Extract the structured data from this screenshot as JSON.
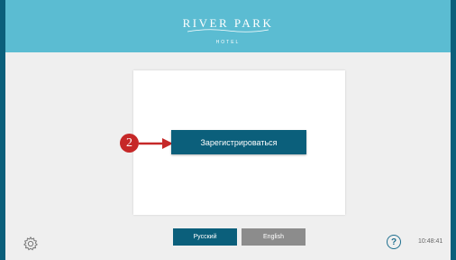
{
  "header": {
    "logo_title": "RIVER PARK",
    "logo_subtitle": "HOTEL"
  },
  "main": {
    "step_marker": "2",
    "register_label": "Зарегистрироваться"
  },
  "languages": [
    "Русский",
    "English"
  ],
  "footer": {
    "time": "10:48:41",
    "help_glyph": "?",
    "settings_icon": "gear-icon",
    "help_icon": "question-circle-icon"
  },
  "colors": {
    "header_bg": "#5bbcd2",
    "primary": "#0b5f7b",
    "secondary_button": "#8c8c8c",
    "marker": "#c62828",
    "background": "#efefef"
  }
}
